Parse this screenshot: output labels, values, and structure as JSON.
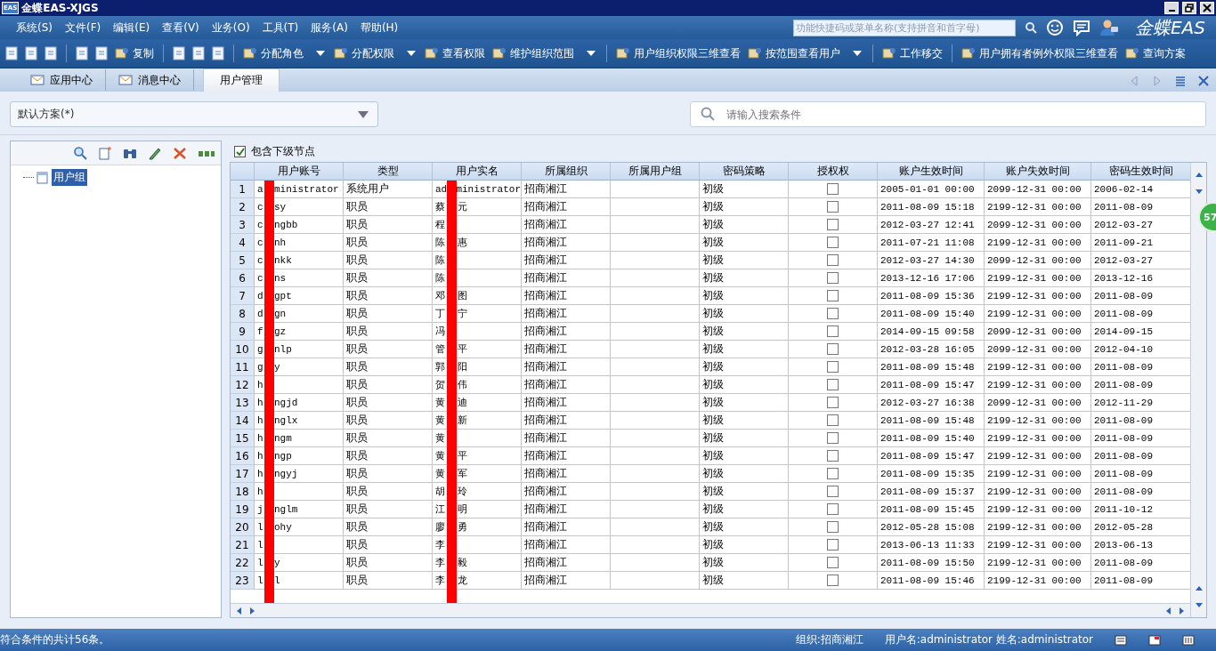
{
  "window": {
    "app_icon_text": "EAS",
    "title": "金蝶EAS-XJGS"
  },
  "menu": [
    "系统(S)",
    "文件(F)",
    "编辑(E)",
    "查看(V)",
    "业务(O)",
    "工具(T)",
    "服务(A)",
    "帮助(H)"
  ],
  "quick_search": {
    "placeholder": "功能快捷码或菜单名称(支持拼音和首字母)"
  },
  "brand": "金蝶EAS",
  "toolbar": [
    {
      "kind": "icon"
    },
    {
      "kind": "icon"
    },
    {
      "kind": "icon"
    },
    {
      "kind": "separator"
    },
    {
      "kind": "icon"
    },
    {
      "kind": "icon"
    },
    {
      "kind": "button",
      "label": "复制",
      "has_menu": false
    },
    {
      "kind": "separator"
    },
    {
      "kind": "icon"
    },
    {
      "kind": "icon"
    },
    {
      "kind": "icon"
    },
    {
      "kind": "separator"
    },
    {
      "kind": "button",
      "label": "分配角色",
      "has_menu": true
    },
    {
      "kind": "button",
      "label": "分配权限",
      "has_menu": true
    },
    {
      "kind": "button",
      "label": "查看权限",
      "has_menu": false
    },
    {
      "kind": "button",
      "label": "维护组织范围",
      "has_menu": true
    },
    {
      "kind": "separator"
    },
    {
      "kind": "button",
      "label": "用户组织权限三维查看",
      "has_menu": false
    },
    {
      "kind": "button",
      "label": "按范围查看用户",
      "has_menu": true
    },
    {
      "kind": "separator"
    },
    {
      "kind": "button",
      "label": "工作移交",
      "has_menu": false
    },
    {
      "kind": "separator"
    },
    {
      "kind": "button",
      "label": "用户拥有者例外权限三维查看",
      "has_menu": false
    },
    {
      "kind": "button",
      "label": "查询方案",
      "has_menu": false
    }
  ],
  "tabs": [
    {
      "label": "应用中心",
      "selected": false
    },
    {
      "label": "消息中心",
      "selected": false
    },
    {
      "label": "用户管理",
      "selected": true
    }
  ],
  "scheme": {
    "value": "默认方案(*)"
  },
  "search": {
    "placeholder": "请输入搜索条件"
  },
  "tree": [
    {
      "label": "用户组",
      "selected": true
    }
  ],
  "include_children": {
    "label": "包含下级节点",
    "checked": true
  },
  "table": {
    "columns": [
      "用户账号",
      "类型",
      "用户实名",
      "所属组织",
      "所属用户组",
      "密码策略",
      "授权权",
      "账户生效时间",
      "账户失效时间",
      "密码生效时间"
    ],
    "rows": [
      {
        "n": "1",
        "account_start": "a",
        "account_end": "ministrator",
        "type": "系统用户",
        "name_start": "ad",
        "name_end": "ministrator",
        "org": "招商湘江",
        "policy": "初级",
        "authorized": false,
        "valid_from": "2005-01-01 00:00",
        "valid_to": "2099-12-31 00:00",
        "pwd_date": "2006-02-14"
      },
      {
        "n": "2",
        "account_start": "c",
        "account_end": "sy",
        "type": "职员",
        "name_start": "蔡",
        "name_end": "元",
        "org": "招商湘江",
        "policy": "初级",
        "authorized": false,
        "valid_from": "2011-08-09 15:18",
        "valid_to": "2199-12-31 00:00",
        "pwd_date": "2011-08-09"
      },
      {
        "n": "3",
        "account_start": "c",
        "account_end": "ngbb",
        "type": "职员",
        "name_start": "程",
        "name_end": "",
        "org": "招商湘江",
        "policy": "初级",
        "authorized": false,
        "valid_from": "2012-03-27 12:41",
        "valid_to": "2099-12-31 00:00",
        "pwd_date": "2012-03-27"
      },
      {
        "n": "4",
        "account_start": "c",
        "account_end": "nh",
        "type": "职员",
        "name_start": "陈",
        "name_end": "惠",
        "org": "招商湘江",
        "policy": "初级",
        "authorized": false,
        "valid_from": "2011-07-21 11:08",
        "valid_to": "2199-12-31 00:00",
        "pwd_date": "2011-09-21"
      },
      {
        "n": "5",
        "account_start": "c",
        "account_end": "nkk",
        "type": "职员",
        "name_start": "陈",
        "name_end": "",
        "org": "招商湘江",
        "policy": "初级",
        "authorized": false,
        "valid_from": "2012-03-27 14:30",
        "valid_to": "2099-12-31 00:00",
        "pwd_date": "2012-03-27"
      },
      {
        "n": "6",
        "account_start": "c",
        "account_end": "ns",
        "type": "职员",
        "name_start": "陈",
        "name_end": "",
        "org": "招商湘江",
        "policy": "初级",
        "authorized": false,
        "valid_from": "2013-12-16 17:06",
        "valid_to": "2199-12-31 00:00",
        "pwd_date": "2013-12-16"
      },
      {
        "n": "7",
        "account_start": "d",
        "account_end": "gpt",
        "type": "职员",
        "name_start": "邓",
        "name_end": "图",
        "org": "招商湘江",
        "policy": "初级",
        "authorized": false,
        "valid_from": "2011-08-09 15:36",
        "valid_to": "2199-12-31 00:00",
        "pwd_date": "2011-08-09"
      },
      {
        "n": "8",
        "account_start": "d",
        "account_end": "gn",
        "type": "职员",
        "name_start": "丁",
        "name_end": "宁",
        "org": "招商湘江",
        "policy": "初级",
        "authorized": false,
        "valid_from": "2011-08-09 15:40",
        "valid_to": "2199-12-31 00:00",
        "pwd_date": "2011-08-09"
      },
      {
        "n": "9",
        "account_start": "f",
        "account_end": "gz",
        "type": "职员",
        "name_start": "冯",
        "name_end": "",
        "org": "招商湘江",
        "policy": "初级",
        "authorized": false,
        "valid_from": "2014-09-15 09:58",
        "valid_to": "2099-12-31 00:00",
        "pwd_date": "2014-09-15"
      },
      {
        "n": "10",
        "account_start": "g",
        "account_end": "nlp",
        "type": "职员",
        "name_start": "管",
        "name_end": "平",
        "org": "招商湘江",
        "policy": "初级",
        "authorized": false,
        "valid_from": "2012-03-28 16:05",
        "valid_to": "2099-12-31 00:00",
        "pwd_date": "2012-04-10"
      },
      {
        "n": "11",
        "account_start": "g",
        "account_end": "y",
        "type": "职员",
        "name_start": "郭",
        "name_end": "阳",
        "org": "招商湘江",
        "policy": "初级",
        "authorized": false,
        "valid_from": "2011-08-09 15:48",
        "valid_to": "2199-12-31 00:00",
        "pwd_date": "2011-08-09"
      },
      {
        "n": "12",
        "account_start": "h",
        "account_end": "",
        "type": "职员",
        "name_start": "贺",
        "name_end": "伟",
        "org": "招商湘江",
        "policy": "初级",
        "authorized": false,
        "valid_from": "2011-08-09 15:47",
        "valid_to": "2199-12-31 00:00",
        "pwd_date": "2011-08-09"
      },
      {
        "n": "13",
        "account_start": "h",
        "account_end": "ngjd",
        "type": "职员",
        "name_start": "黄",
        "name_end": "迪",
        "org": "招商湘江",
        "policy": "初级",
        "authorized": false,
        "valid_from": "2012-03-27 16:38",
        "valid_to": "2099-12-31 00:00",
        "pwd_date": "2012-11-29"
      },
      {
        "n": "14",
        "account_start": "h",
        "account_end": "nglx",
        "type": "职员",
        "name_start": "黄",
        "name_end": "新",
        "org": "招商湘江",
        "policy": "初级",
        "authorized": false,
        "valid_from": "2011-08-09 15:48",
        "valid_to": "2199-12-31 00:00",
        "pwd_date": "2011-08-09"
      },
      {
        "n": "15",
        "account_start": "h",
        "account_end": "ngm",
        "type": "职员",
        "name_start": "黄",
        "name_end": "",
        "org": "招商湘江",
        "policy": "初级",
        "authorized": false,
        "valid_from": "2011-08-09 15:40",
        "valid_to": "2199-12-31 00:00",
        "pwd_date": "2011-08-09"
      },
      {
        "n": "16",
        "account_start": "h",
        "account_end": "ngp",
        "type": "职员",
        "name_start": "黄",
        "name_end": "平",
        "org": "招商湘江",
        "policy": "初级",
        "authorized": false,
        "valid_from": "2011-08-09 15:47",
        "valid_to": "2199-12-31 00:00",
        "pwd_date": "2011-08-09"
      },
      {
        "n": "17",
        "account_start": "h",
        "account_end": "ngyj",
        "type": "职员",
        "name_start": "黄",
        "name_end": "军",
        "org": "招商湘江",
        "policy": "初级",
        "authorized": false,
        "valid_from": "2011-08-09 15:35",
        "valid_to": "2199-12-31 00:00",
        "pwd_date": "2011-08-09"
      },
      {
        "n": "18",
        "account_start": "h",
        "account_end": "",
        "type": "职员",
        "name_start": "胡",
        "name_end": "玲",
        "org": "招商湘江",
        "policy": "初级",
        "authorized": false,
        "valid_from": "2011-08-09 15:37",
        "valid_to": "2199-12-31 00:00",
        "pwd_date": "2011-08-09"
      },
      {
        "n": "19",
        "account_start": "j",
        "account_end": "nglm",
        "type": "职员",
        "name_start": "江",
        "name_end": "明",
        "org": "招商湘江",
        "policy": "初级",
        "authorized": false,
        "valid_from": "2011-08-09 15:45",
        "valid_to": "2199-12-31 00:00",
        "pwd_date": "2011-10-12"
      },
      {
        "n": "20",
        "account_start": "l",
        "account_end": "ohy",
        "type": "职员",
        "name_start": "廖",
        "name_end": "勇",
        "org": "招商湘江",
        "policy": "初级",
        "authorized": false,
        "valid_from": "2012-05-28 15:08",
        "valid_to": "2199-12-31 00:00",
        "pwd_date": "2012-05-28"
      },
      {
        "n": "21",
        "account_start": "l",
        "account_end": "",
        "type": "职员",
        "name_start": "李",
        "name_end": "",
        "org": "招商湘江",
        "policy": "初级",
        "authorized": false,
        "valid_from": "2013-06-13 11:33",
        "valid_to": "2199-12-31 00:00",
        "pwd_date": "2013-06-13"
      },
      {
        "n": "22",
        "account_start": "l",
        "account_end": "y",
        "type": "职员",
        "name_start": "李",
        "name_end": "毅",
        "org": "招商湘江",
        "policy": "初级",
        "authorized": false,
        "valid_from": "2011-08-09 15:50",
        "valid_to": "2199-12-31 00:00",
        "pwd_date": "2011-08-09"
      },
      {
        "n": "23",
        "account_start": "l",
        "account_end": "l",
        "type": "职员",
        "name_start": "李",
        "name_end": "龙",
        "org": "招商湘江",
        "policy": "初级",
        "authorized": false,
        "valid_from": "2011-08-09 15:46",
        "valid_to": "2199-12-31 00:00",
        "pwd_date": "2011-08-09"
      }
    ]
  },
  "floating_badge": "57",
  "status_bar": {
    "message": "符合条件的共计56条。",
    "org": "组织:招商湘江",
    "user": "用户名:administrator 姓名:administrator"
  }
}
